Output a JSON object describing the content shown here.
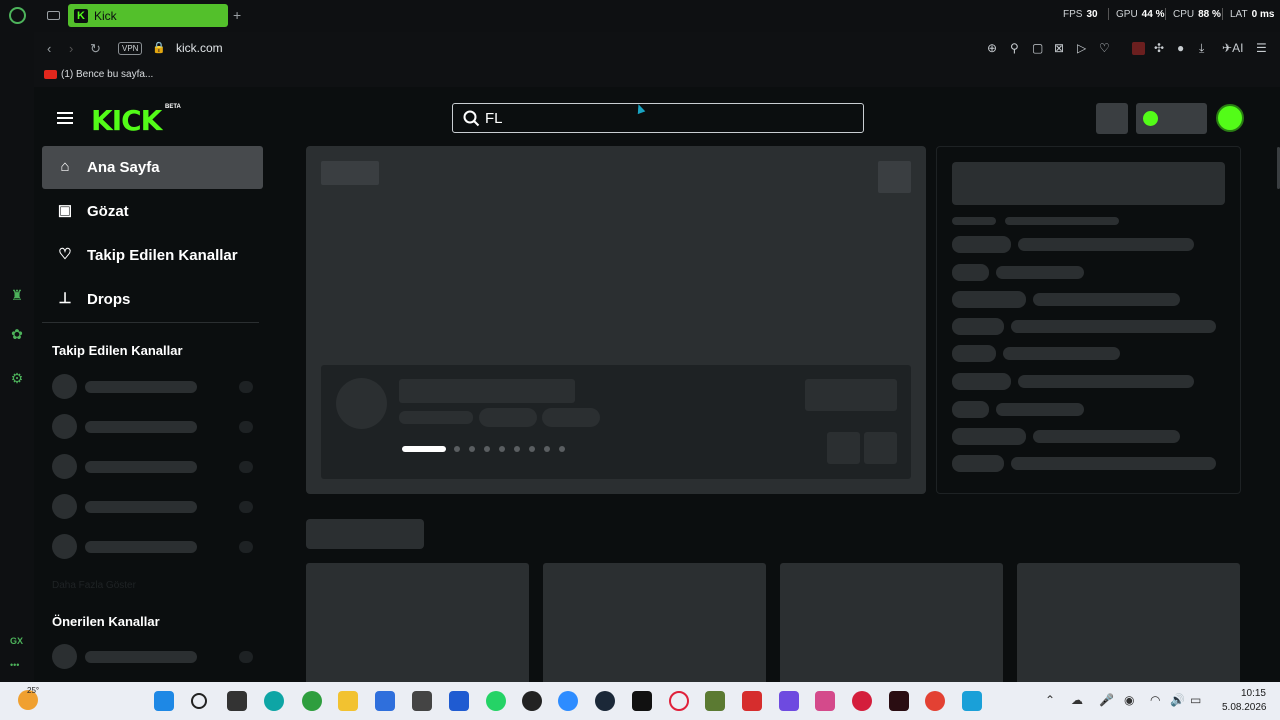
{
  "browser": {
    "tab_title": "Kick",
    "tab_icon_letter": "K",
    "new_tab": "+",
    "stats": {
      "fps_label": "FPS",
      "fps_value": "30",
      "gpu_label": "GPU",
      "gpu_value": "44 %",
      "cpu_label": "CPU",
      "cpu_value": "88 %",
      "lat_label": "LAT",
      "lat_value": "0 ms"
    },
    "vpn_label": "VPN",
    "url": "kick.com",
    "ai_label": "AI",
    "bookmark": "(1) Bence bu sayfa..."
  },
  "gx_sidebar": {
    "gx_label": "GX",
    "more": "•••"
  },
  "kick": {
    "logo_text": "KICK",
    "beta": "BETA",
    "search_value": "FL",
    "nav": [
      {
        "label": "Ana Sayfa",
        "icon": "home-icon",
        "glyph": "⌂"
      },
      {
        "label": "Gözat",
        "icon": "browse-icon",
        "glyph": "▣"
      },
      {
        "label": "Takip Edilen Kanallar",
        "icon": "heart-icon",
        "glyph": "♡"
      },
      {
        "label": "Drops",
        "icon": "drops-icon",
        "glyph": "⊥"
      }
    ],
    "followed_heading": "Takip Edilen Kanallar",
    "show_more": "Daha Fazla Göster",
    "recommended_heading": "Önerilen Kanallar"
  },
  "taskbar": {
    "weather": "25°",
    "time": "10:15",
    "date": "5.08.2026"
  }
}
